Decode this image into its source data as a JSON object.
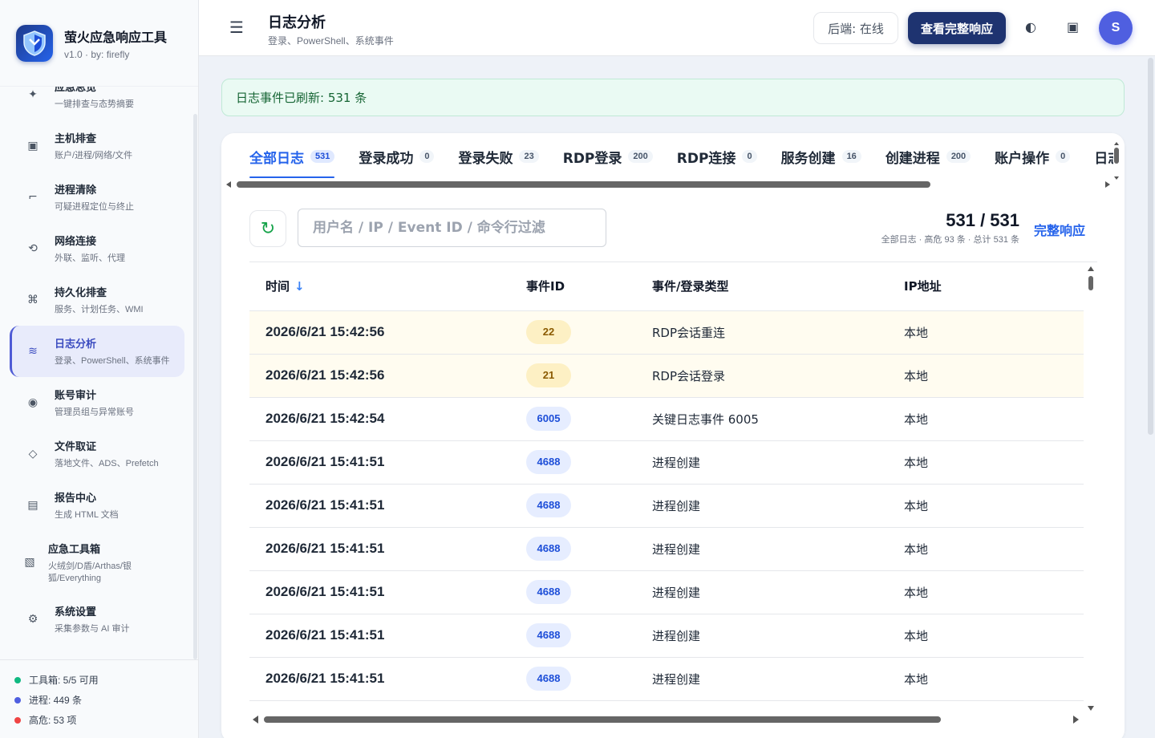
{
  "brand": {
    "title": "萤火应急响应工具",
    "subtitle": "v1.0 · by: firefly"
  },
  "sidebar": {
    "items": [
      {
        "label": "应急总览",
        "desc": "一键排查与态势摘要",
        "icon": "sparkle-icon"
      },
      {
        "label": "主机排查",
        "desc": "账户/进程/网络/文件",
        "icon": "square-icon"
      },
      {
        "label": "进程清除",
        "desc": "可疑进程定位与终止",
        "icon": "dash-icon"
      },
      {
        "label": "网络连接",
        "desc": "外联、监听、代理",
        "icon": "refresh-icon"
      },
      {
        "label": "持久化排查",
        "desc": "服务、计划任务、WMI",
        "icon": "command-icon"
      },
      {
        "label": "日志分析",
        "desc": "登录、PowerShell、系统事件",
        "icon": "wave-icon"
      },
      {
        "label": "账号审计",
        "desc": "管理员组与异常账号",
        "icon": "radio-icon"
      },
      {
        "label": "文件取证",
        "desc": "落地文件、ADS、Prefetch",
        "icon": "diamond-icon"
      },
      {
        "label": "报告中心",
        "desc": "生成 HTML 文档",
        "icon": "document-icon"
      },
      {
        "label": "应急工具箱",
        "desc": "火绒剑/D盾/Arthas/银狐/Everything",
        "icon": "toolbox-icon"
      },
      {
        "label": "系统设置",
        "desc": "采集参数与 AI 审计",
        "icon": "gear-icon"
      }
    ],
    "stats": [
      {
        "text": "工具箱: 5/5 可用",
        "color": "#10b981"
      },
      {
        "text": "进程: 449 条",
        "color": "#4f5fe0"
      },
      {
        "text": "高危: 53 项",
        "color": "#ef4444"
      }
    ]
  },
  "header": {
    "menu_icon": "☰",
    "title": "日志分析",
    "subtitle": "登录、PowerShell、系统事件",
    "backend_status": "后端: 在线",
    "primary_button": "查看完整响应",
    "theme_icon": "◐",
    "window_icon": "▣",
    "avatar": "S"
  },
  "toast": "日志事件已刷新: 531 条",
  "tabs": [
    {
      "label": "全部日志",
      "count": "531",
      "active": true
    },
    {
      "label": "登录成功",
      "count": "0"
    },
    {
      "label": "登录失败",
      "count": "23"
    },
    {
      "label": "RDP登录",
      "count": "200"
    },
    {
      "label": "RDP连接",
      "count": "0"
    },
    {
      "label": "服务创建",
      "count": "16"
    },
    {
      "label": "创建进程",
      "count": "200"
    },
    {
      "label": "账户操作",
      "count": "0"
    },
    {
      "label": "日志服务",
      "count": ""
    }
  ],
  "toolbar": {
    "refresh_icon": "↻",
    "search_placeholder": "用户名 / IP / Event ID / 命令行过滤",
    "counter": "531 / 531",
    "counter_sub": "全部日志 · 高危 93 条 · 总计 531 条",
    "link": "完整响应"
  },
  "table": {
    "headers": {
      "time": "时间",
      "sort_icon": "↓",
      "event_id": "事件ID",
      "type": "事件/登录类型",
      "ip": "IP地址"
    },
    "rows": [
      {
        "time": "2026/6/21 15:42:56",
        "id": "22",
        "type": "RDP会话重连",
        "ip": "本地",
        "level": "warn"
      },
      {
        "time": "2026/6/21 15:42:56",
        "id": "21",
        "type": "RDP会话登录",
        "ip": "本地",
        "level": "warn"
      },
      {
        "time": "2026/6/21 15:42:54",
        "id": "6005",
        "type": "关键日志事件 6005",
        "ip": "本地",
        "level": "normal"
      },
      {
        "time": "2026/6/21 15:41:51",
        "id": "4688",
        "type": "进程创建",
        "ip": "本地",
        "level": "normal"
      },
      {
        "time": "2026/6/21 15:41:51",
        "id": "4688",
        "type": "进程创建",
        "ip": "本地",
        "level": "normal"
      },
      {
        "time": "2026/6/21 15:41:51",
        "id": "4688",
        "type": "进程创建",
        "ip": "本地",
        "level": "normal"
      },
      {
        "time": "2026/6/21 15:41:51",
        "id": "4688",
        "type": "进程创建",
        "ip": "本地",
        "level": "normal"
      },
      {
        "time": "2026/6/21 15:41:51",
        "id": "4688",
        "type": "进程创建",
        "ip": "本地",
        "level": "normal"
      },
      {
        "time": "2026/6/21 15:41:51",
        "id": "4688",
        "type": "进程创建",
        "ip": "本地",
        "level": "normal"
      }
    ]
  }
}
